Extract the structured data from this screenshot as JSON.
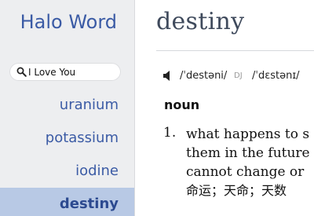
{
  "sidebar": {
    "app_title": "Halo Word",
    "search": {
      "value": "I Love You",
      "placeholder": ""
    },
    "words": [
      {
        "label": "uranium",
        "selected": false
      },
      {
        "label": "potassium",
        "selected": false
      },
      {
        "label": "iodine",
        "selected": false
      },
      {
        "label": "destiny",
        "selected": true
      }
    ]
  },
  "entry": {
    "headword": "destiny",
    "pronunciation": {
      "uk": "/ˈdestəni/",
      "tag": "DJ",
      "us": "/ˈdɛstənɪ/"
    },
    "part_of_speech": "noun",
    "definitions": [
      {
        "number": "1.",
        "lines": [
          "what happens to s",
          "them in the future",
          "cannot change or"
        ],
        "translation": "命运；天命；天数"
      }
    ]
  },
  "colors": {
    "sidebar_bg": "#edeef0",
    "accent": "#3b5ba5",
    "selected_bg": "#b8c9e5",
    "headword": "#3f4a5c"
  },
  "icons": {
    "search": "magnifier-icon",
    "pronounce": "speaker-icon"
  }
}
